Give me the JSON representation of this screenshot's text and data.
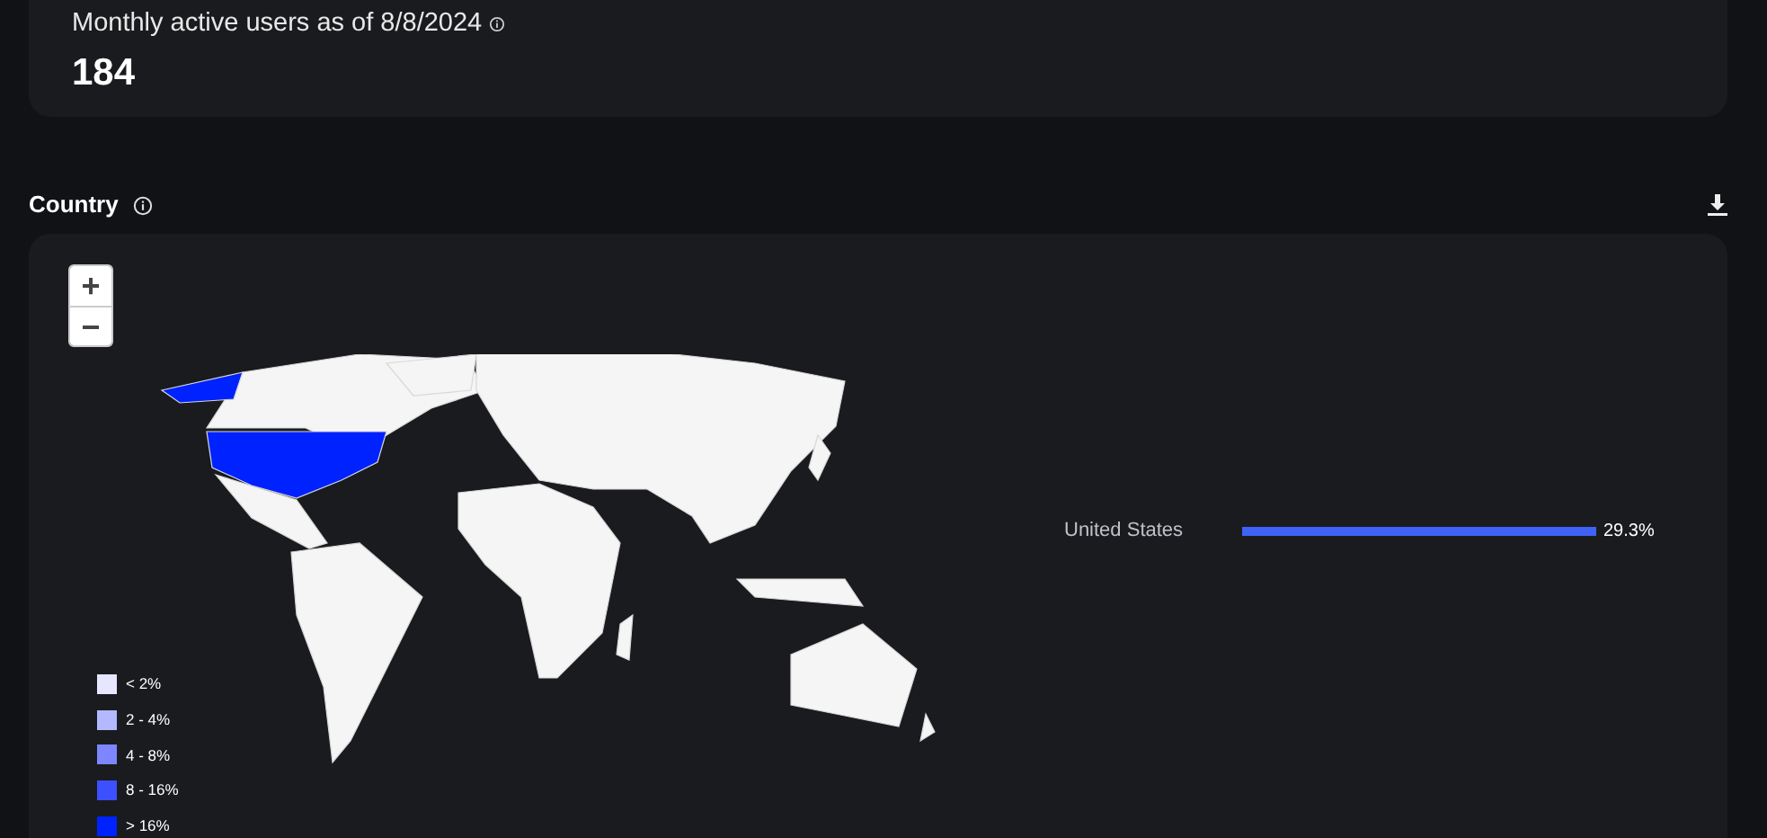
{
  "summary": {
    "label": "Monthly active users as of 8/8/2024",
    "value": "184"
  },
  "country": {
    "title": "Country",
    "zoom_controls": [
      "+",
      "−"
    ],
    "legend": [
      {
        "label": "< 2%",
        "color": "#e6e6ff"
      },
      {
        "label": "2 - 4%",
        "color": "#b3b8ff"
      },
      {
        "label": "4 - 8%",
        "color": "#7d86ff"
      },
      {
        "label": "8 - 16%",
        "color": "#3d50ff"
      },
      {
        "label": "> 16%",
        "color": "#0022ff"
      }
    ],
    "rows": [
      {
        "name": "United States",
        "value": "29.3%",
        "level": 1
      }
    ]
  }
}
